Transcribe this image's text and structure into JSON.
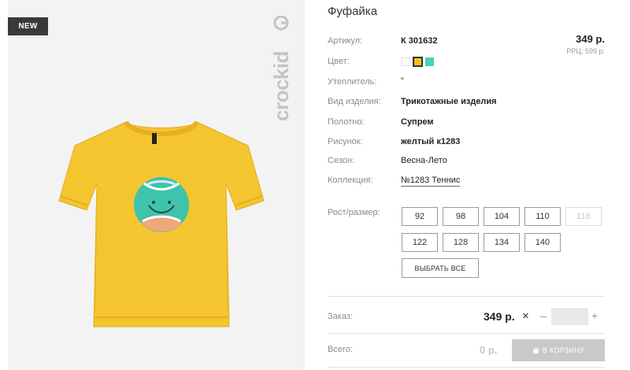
{
  "image": {
    "badge": "NEW",
    "brand_logo": "crockid"
  },
  "product": {
    "title": "Фуфайка",
    "price": "349 р.",
    "rrp": "РРЦ: 599 р.",
    "attributes": [
      {
        "label": "Артикул:",
        "value": "К 301632"
      },
      {
        "label": "Цвет:",
        "value": ""
      },
      {
        "label": "Утеплитель:",
        "value": "\""
      },
      {
        "label": "Вид изделия:",
        "value": "Трикотажные изделия"
      },
      {
        "label": "Полотно:",
        "value": "Супрем"
      },
      {
        "label": "Рисунок:",
        "value": "желтый к1283"
      },
      {
        "label": "Сезон:",
        "value": "Весна-Лето"
      },
      {
        "label": "Коллекция:",
        "value": "№1283 Теннис"
      }
    ],
    "colors": [
      "#ffffff",
      "#f2c21a",
      "#47d0b6"
    ],
    "selected_color": "#f2c21a"
  },
  "sizes": {
    "label": "Рост/размер:",
    "options": [
      "92",
      "98",
      "104",
      "110",
      "116",
      "122",
      "128",
      "134",
      "140"
    ],
    "disabled": [
      "116"
    ],
    "select_all": "ВЫБРАТЬ ВСЕ"
  },
  "order": {
    "label": "Заказ:",
    "price": "349 р.",
    "times": "×",
    "minus": "–",
    "plus": "+",
    "quantity": ""
  },
  "total": {
    "label": "Всего:",
    "value": "0 р.",
    "cart_button": "В КОРЗИНУ"
  }
}
